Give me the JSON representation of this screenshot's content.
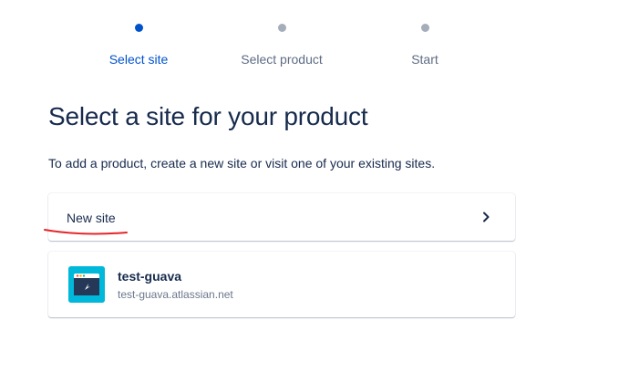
{
  "stepper": {
    "steps": [
      {
        "label": "Select site",
        "active": true
      },
      {
        "label": "Select product",
        "active": false
      },
      {
        "label": "Start",
        "active": false
      }
    ]
  },
  "page": {
    "title": "Select a site for your product",
    "subtitle": "To add a product, create a new site or visit one of your existing sites."
  },
  "new_site": {
    "label": "New site",
    "icon": "chevron-right-icon"
  },
  "sites": [
    {
      "name": "test-guava",
      "url": "test-guava.atlassian.net",
      "icon": "site-browser-icon"
    }
  ],
  "colors": {
    "accent": "#0052cc",
    "text": "#172b4d",
    "muted": "#5e6c84",
    "dot_inactive": "#a5adba",
    "site_logo_bg": "#00b8d9",
    "annotation": "#e5252a"
  }
}
